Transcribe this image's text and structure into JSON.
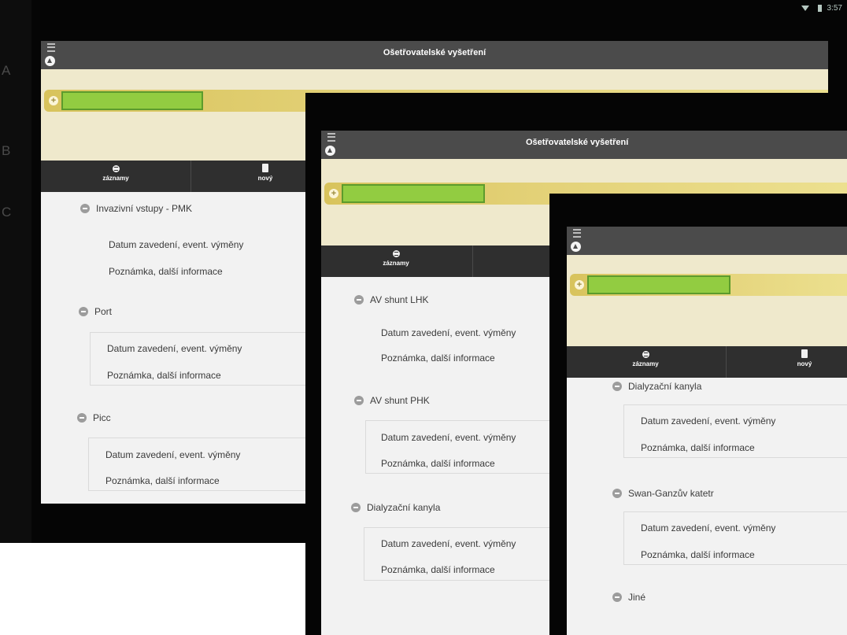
{
  "side_letters": [
    "A",
    "B",
    "C"
  ],
  "status": {
    "time": "3:57"
  },
  "app": {
    "title": "Ošetřovatelské vyšetření"
  },
  "toolbar": {
    "records_label": "záznamy",
    "new_label": "nový"
  },
  "field_labels": {
    "date": "Datum zavedení, event. výměny",
    "note": "Poznámka, další informace"
  },
  "screens": [
    {
      "sections": [
        "Invazivní vstupy - PMK",
        "Port",
        "Picc"
      ]
    },
    {
      "sections": [
        "AV shunt LHK",
        "AV shunt PHK",
        "Dialyzační kanyla"
      ]
    },
    {
      "sections": [
        "Dialyzační kanyla",
        "Swan-Ganzův katetr",
        "Jiné"
      ]
    }
  ],
  "colors": {
    "header": "#4b4b4b",
    "toolbar": "#2f2f2f",
    "yellow_band": "#e3d177",
    "redaction_green": "#92cc41",
    "content_bg": "#f2f2f2"
  }
}
